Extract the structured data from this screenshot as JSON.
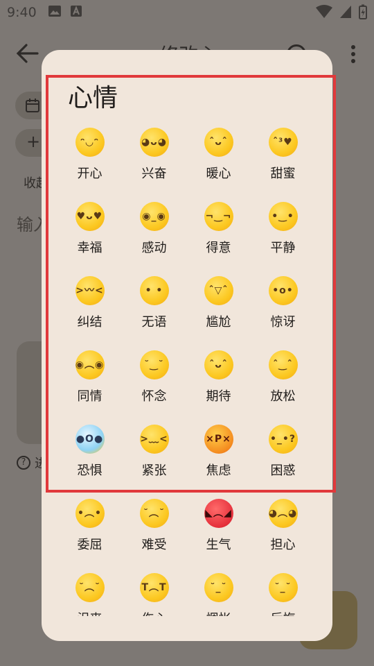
{
  "status_bar": {
    "time": "9:40"
  },
  "app": {
    "title": "修改心",
    "collect_label": "收起",
    "input_hint": "输入",
    "help_text": "进"
  },
  "dialog": {
    "title": "心情",
    "moods": [
      {
        "label": "开心",
        "face": "ᵔ◡ᵔ"
      },
      {
        "label": "兴奋",
        "face": "◕ᴗ◕"
      },
      {
        "label": "暖心",
        "face": "ˆᴗˆ"
      },
      {
        "label": "甜蜜",
        "face": "ˆ³♥"
      },
      {
        "label": "幸福",
        "face": "♥ᴗ♥"
      },
      {
        "label": "感动",
        "face": "◉_◉"
      },
      {
        "label": "得意",
        "face": "¬‿¬"
      },
      {
        "label": "平静",
        "face": "•‿•"
      },
      {
        "label": "纠结",
        "face": ">〰<"
      },
      {
        "label": "无语",
        "face": "• •"
      },
      {
        "label": "尴尬",
        "face": "ˆ▽ˆ"
      },
      {
        "label": "惊讶",
        "face": "•o•"
      },
      {
        "label": "同情",
        "face": "◉︵◉"
      },
      {
        "label": "怀念",
        "face": "˘‿˘"
      },
      {
        "label": "期待",
        "face": "ˆᴗˆ"
      },
      {
        "label": "放松",
        "face": "ˆ‿ˆ"
      },
      {
        "label": "恐惧",
        "face": "●O●"
      },
      {
        "label": "紧张",
        "face": ">﹏<"
      },
      {
        "label": "焦虑",
        "face": "×P×"
      },
      {
        "label": "困惑",
        "face": "•_•?"
      },
      {
        "label": "委屈",
        "face": "•︵•"
      },
      {
        "label": "难受",
        "face": "˘︵˘"
      },
      {
        "label": "生气",
        "face": "◣︵◢"
      },
      {
        "label": "担心",
        "face": "◕︵◕"
      },
      {
        "label": "沮丧",
        "face": "˘︵˘"
      },
      {
        "label": "伤心",
        "face": "T︵T"
      },
      {
        "label": "惆怅",
        "face": "˘_˘"
      },
      {
        "label": "后悔",
        "face": "˘_˘"
      }
    ]
  },
  "colors": {
    "highlight": "#e1393b",
    "dialog_bg": "#f1e6db",
    "scrim": "#7d7874"
  }
}
